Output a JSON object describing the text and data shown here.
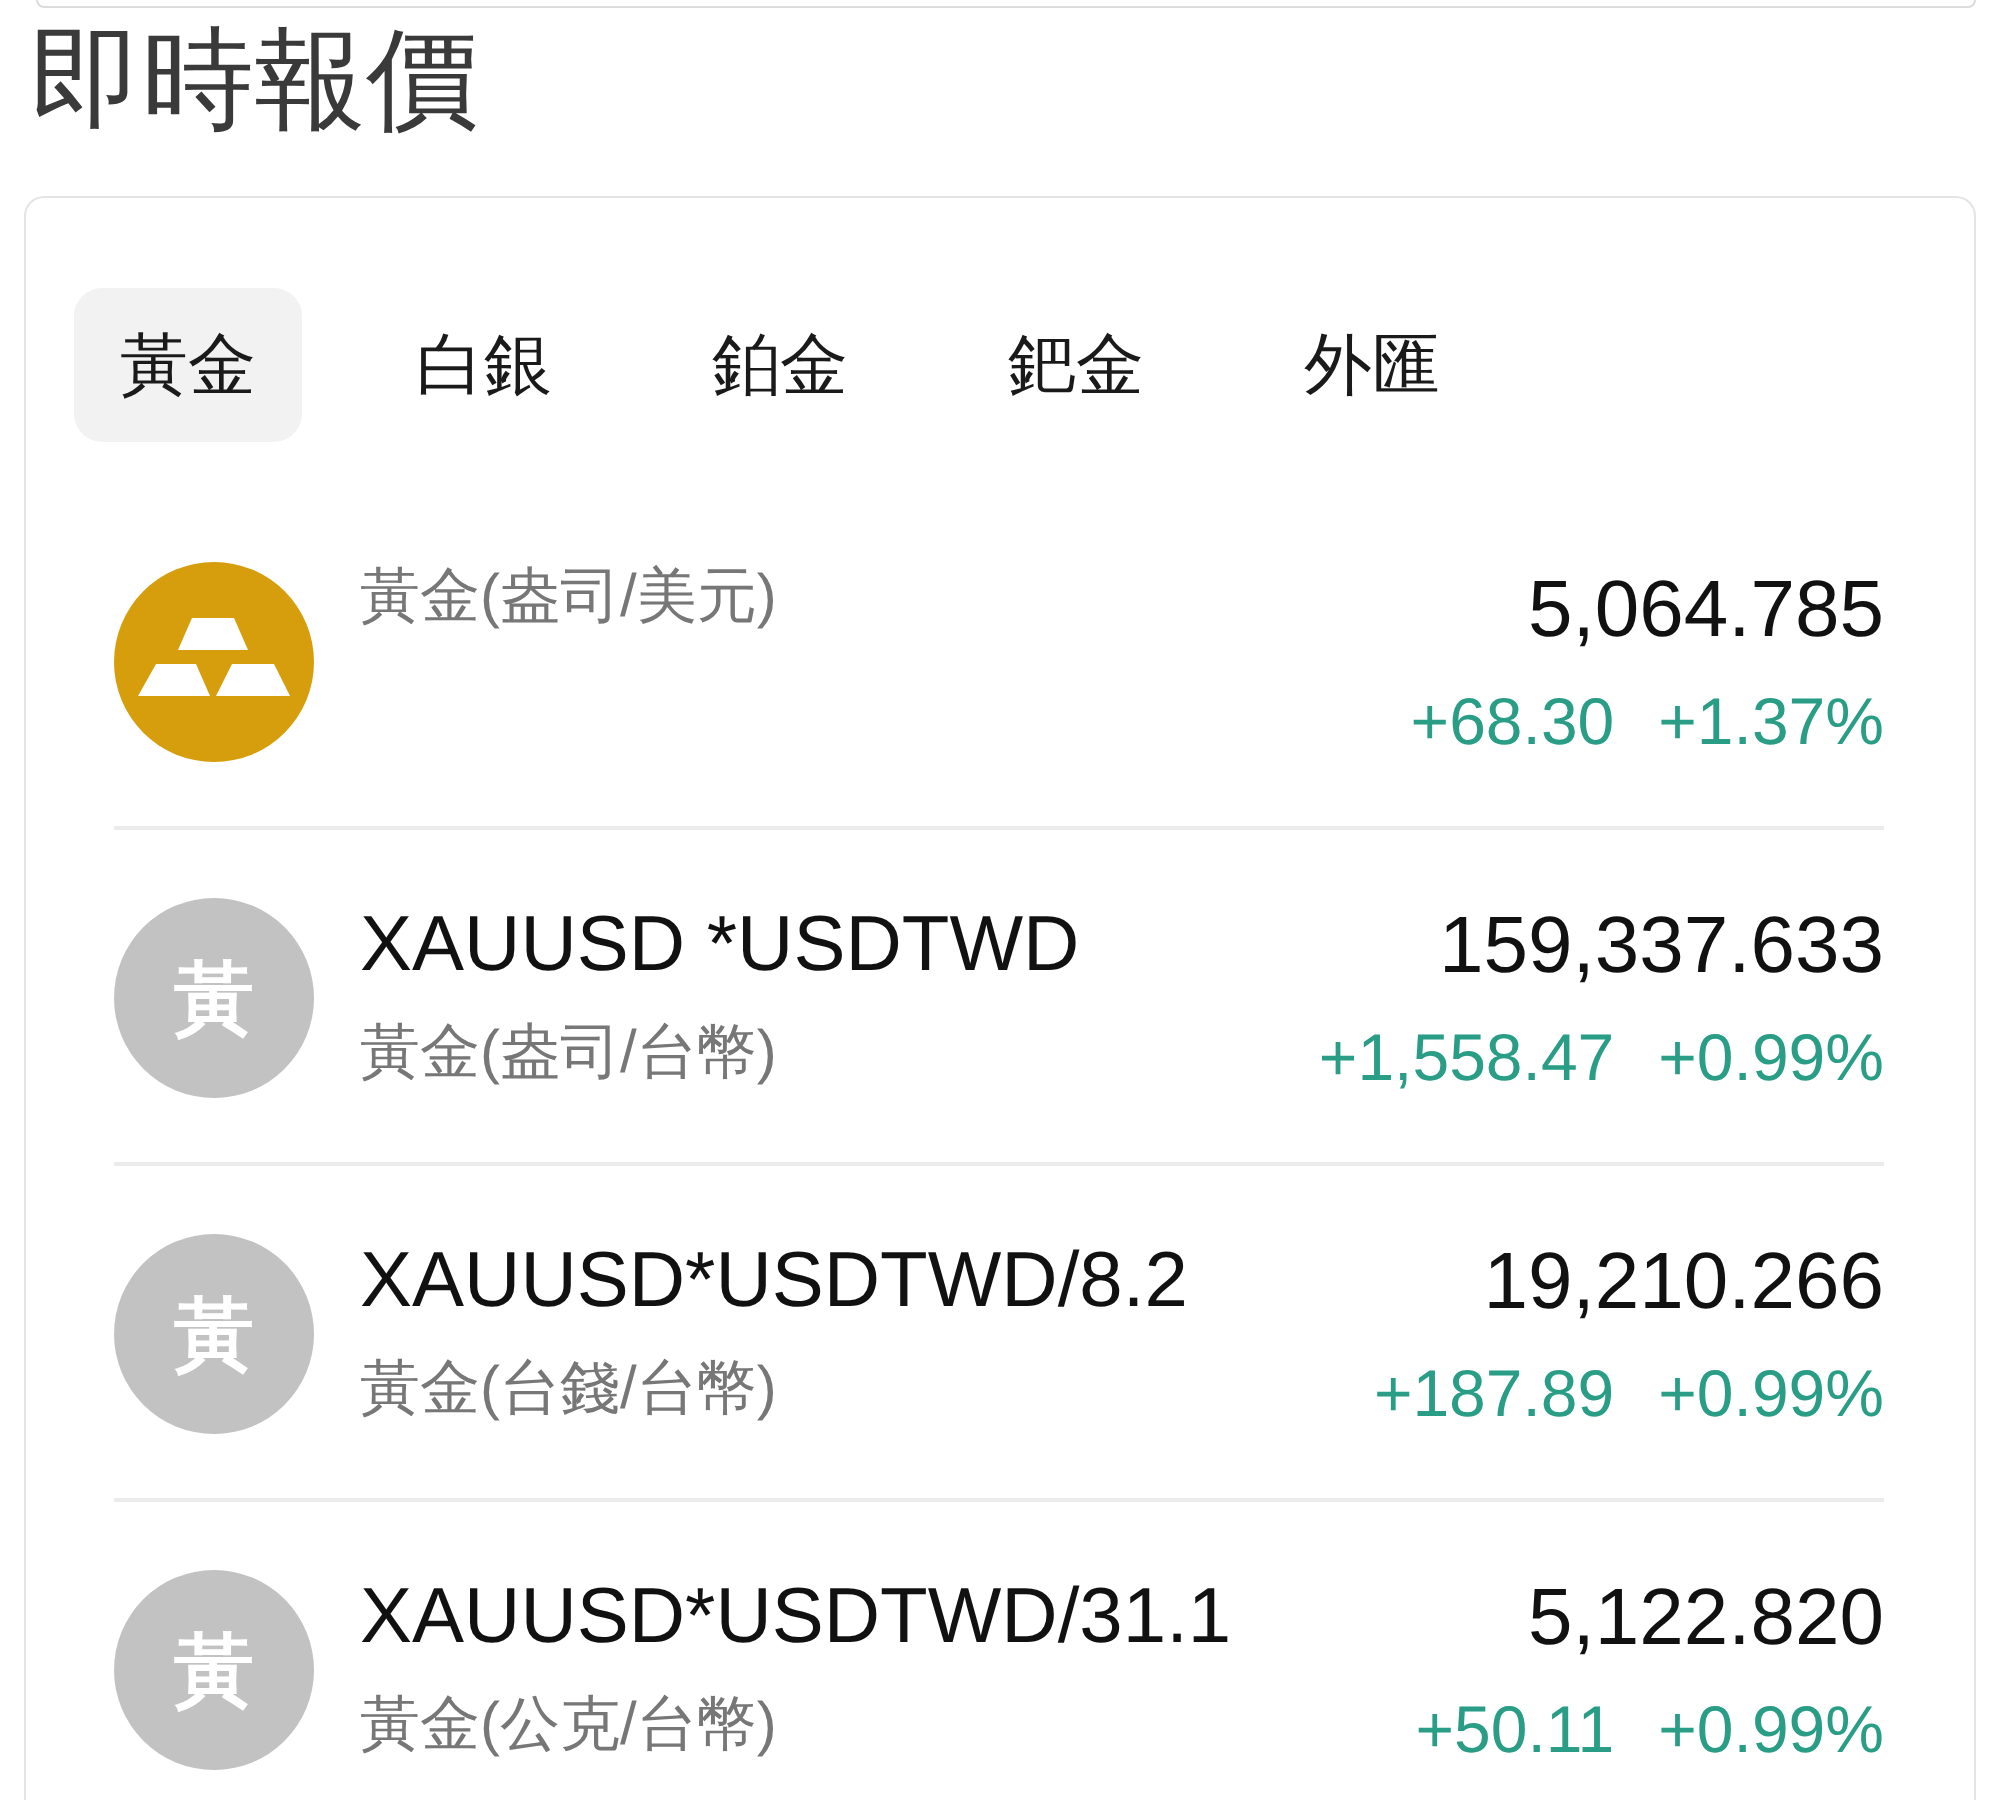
{
  "page_title": "即時報價",
  "tabs": [
    {
      "label": "黃金",
      "selected": true
    },
    {
      "label": "白銀",
      "selected": false
    },
    {
      "label": "鉑金",
      "selected": false
    },
    {
      "label": "鈀金",
      "selected": false
    },
    {
      "label": "外匯",
      "selected": false
    }
  ],
  "quotes": [
    {
      "kind": "icon",
      "name": "黃金(盎司/美元)",
      "price": "5,064.785",
      "change": "+68.30",
      "change_percent": "+1.37%",
      "rising": true
    },
    {
      "kind": "letter",
      "avatar_text": "黃",
      "symbol": "XAUUSD *USDTWD",
      "name": "黃金(盎司/台幣)",
      "price": "159,337.633",
      "change": "+1,558.47",
      "change_percent": "+0.99%",
      "rising": true
    },
    {
      "kind": "letter",
      "avatar_text": "黃",
      "symbol": "XAUUSD*USDTWD/8.2",
      "name": "黃金(台錢/台幣)",
      "price": "19,210.266",
      "change": "+187.89",
      "change_percent": "+0.99%",
      "rising": true
    },
    {
      "kind": "letter",
      "avatar_text": "黃",
      "symbol": "XAUUSD*USDTWD/31.1",
      "name": "黃金(公克/台幣)",
      "price": "5,122.820",
      "change": "+50.11",
      "change_percent": "+0.99%",
      "rising": true
    }
  ]
}
